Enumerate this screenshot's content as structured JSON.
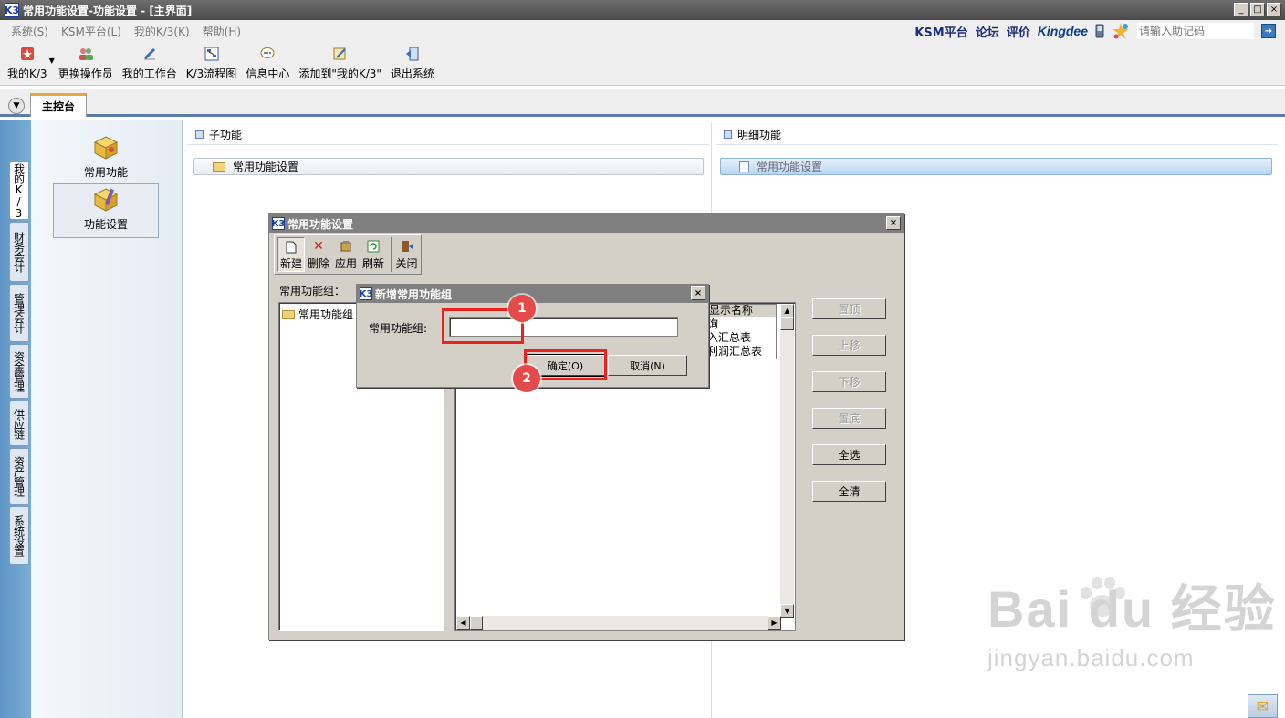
{
  "window": {
    "logo": "K3",
    "title": "常用功能设置-功能设置 - [主界面]",
    "minimize": "_",
    "maximize": "□",
    "close": "×"
  },
  "menu": {
    "items": [
      "系统(S)",
      "KSM平台(L)",
      "我的K/3(K)",
      "帮助(H)"
    ],
    "links": [
      "KSM平台",
      "论坛",
      "评价"
    ],
    "brand": "Kingdee",
    "search_placeholder": "请输入助记码",
    "go": "➔"
  },
  "toolbar": {
    "items": [
      {
        "label": "我的K/3",
        "icon": "star-icon"
      },
      {
        "label": "更换操作员",
        "icon": "users-icon"
      },
      {
        "label": "我的工作台",
        "icon": "pen-icon"
      },
      {
        "label": "K/3流程图",
        "icon": "flowchart-icon"
      },
      {
        "label": "信息中心",
        "icon": "message-icon"
      },
      {
        "label": "添加到\"我的K/3\"",
        "icon": "add-icon"
      },
      {
        "label": "退出系统",
        "icon": "exit-icon"
      }
    ]
  },
  "tabs": {
    "dropdown": "▼",
    "main": "主控台"
  },
  "left_tabs": [
    "我的K/3",
    "财务会计",
    "管理会计",
    "资金管理",
    "供应链",
    "资产管理",
    "系统设置"
  ],
  "nav": {
    "items": [
      "常用功能",
      "功能设置"
    ]
  },
  "panes": {
    "sub_title": "子功能",
    "sub_item": "常用功能设置",
    "detail_title": "明细功能",
    "detail_item": "常用功能设置"
  },
  "dialog1": {
    "title": "常用功能设置",
    "close": "×",
    "tools": [
      "新建",
      "删除",
      "应用",
      "刷新",
      "关闭"
    ],
    "group_label": "常用功能组：",
    "tree_item": "常用功能组",
    "list_header": "显示名称",
    "list_rows": [
      "询",
      "入汇总表",
      "利润汇总表"
    ],
    "side_buttons": [
      "置顶",
      "上移",
      "下移",
      "置底",
      "全选",
      "全清"
    ]
  },
  "dialog2": {
    "title": "新增常用功能组",
    "close": "×",
    "field_label": "常用功能组:",
    "field_value": "",
    "ok": "确定(O)",
    "cancel": "取消(N)"
  },
  "annotations": [
    "1",
    "2"
  ],
  "watermark": {
    "brand": "Bai du 经验",
    "url": "jingyan.baidu.com"
  },
  "colors": {
    "title_bar": "#5a5a5a",
    "tab_accent": "#e9a640",
    "highlight_red": "#e8231f",
    "badge_red": "#e44a4a",
    "left_rail": "#6aa0cf"
  }
}
